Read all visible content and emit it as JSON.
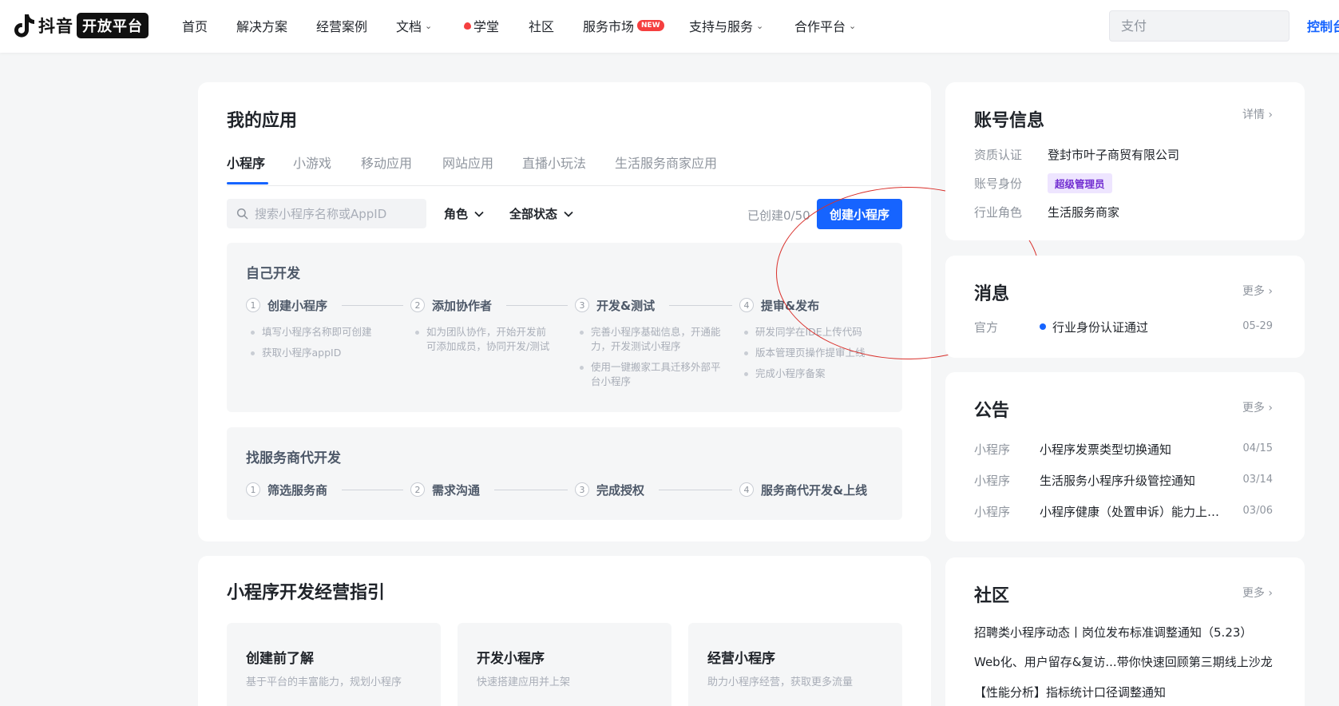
{
  "nav": {
    "logo_text": "抖音",
    "logo_badge": "开放平台",
    "items": [
      {
        "label": "首页"
      },
      {
        "label": "解决方案"
      },
      {
        "label": "经营案例"
      },
      {
        "label": "文档"
      },
      {
        "label": "学堂"
      },
      {
        "label": "社区"
      },
      {
        "label": "服务市场"
      },
      {
        "label": "支持与服务"
      },
      {
        "label": "合作平台"
      }
    ],
    "new_badge": "NEW",
    "search_placeholder": "支付",
    "console_label": "控制台",
    "colors": {
      "accent": "#1664ff",
      "hot": "#f53f3f"
    }
  },
  "my_apps": {
    "title": "我的应用",
    "tabs": [
      "小程序",
      "小游戏",
      "移动应用",
      "网站应用",
      "直播小玩法",
      "生活服务商家应用"
    ],
    "active_tab": "小程序",
    "search_placeholder": "搜索小程序名称或AppID",
    "role_filter": "角色",
    "status_filter": "全部状态",
    "created_count": "已创建0/50",
    "create_button": "创建小程序",
    "self_dev": {
      "title": "自己开发",
      "steps": [
        {
          "num": "1",
          "label": "创建小程序",
          "bullets": [
            "填写小程序名称即可创建",
            "获取小程序appID"
          ]
        },
        {
          "num": "2",
          "label": "添加协作者",
          "bullets": [
            "如为团队协作，开始开发前可添加成员，协同开发/测试"
          ]
        },
        {
          "num": "3",
          "label": "开发&测试",
          "bullets": [
            "完善小程序基础信息，开通能力，开发测试小程序",
            "使用一键搬家工具迁移外部平台小程序"
          ]
        },
        {
          "num": "4",
          "label": "提审&发布",
          "bullets": [
            "研发同学在IDE上传代码",
            "版本管理页操作提审上线",
            "完成小程序备案"
          ]
        }
      ]
    },
    "service_dev": {
      "title": "找服务商代开发",
      "steps": [
        {
          "num": "1",
          "label": "筛选服务商"
        },
        {
          "num": "2",
          "label": "需求沟通"
        },
        {
          "num": "3",
          "label": "完成授权"
        },
        {
          "num": "4",
          "label": "服务商代开发&上线"
        }
      ]
    },
    "annotation_color": "#d9302b"
  },
  "guide": {
    "title": "小程序开发经营指引",
    "cards": [
      {
        "title": "创建前了解",
        "desc": "基于平台的丰富能力，规划小程序"
      },
      {
        "title": "开发小程序",
        "desc": "快速搭建应用并上架"
      },
      {
        "title": "经营小程序",
        "desc": "助力小程序经营，获取更多流量"
      }
    ]
  },
  "account": {
    "title": "账号信息",
    "more": "详情",
    "rows": [
      {
        "label": "资质认证",
        "value": "登封市叶子商贸有限公司"
      },
      {
        "label": "账号身份",
        "value": "超级管理员"
      },
      {
        "label": "行业角色",
        "value": "生活服务商家"
      }
    ]
  },
  "messages": {
    "title": "消息",
    "more": "更多",
    "items": [
      {
        "source": "官方",
        "text": "行业身份认证通过",
        "date": "05-29"
      }
    ]
  },
  "announcements": {
    "title": "公告",
    "more": "更多",
    "items": [
      {
        "tag": "小程序",
        "title": "小程序发票类型切换通知",
        "date": "04/15"
      },
      {
        "tag": "小程序",
        "title": "生活服务小程序升级管控通知",
        "date": "03/14"
      },
      {
        "tag": "小程序",
        "title": "小程序健康（处置申诉）能力上线通知",
        "date": "03/06"
      }
    ]
  },
  "community": {
    "title": "社区",
    "more": "更多",
    "items": [
      "招聘类小程序动态丨岗位发布标准调整通知（5.23）",
      "Web化、用户留存&复访...带你快速回顾第三期线上沙龙",
      "【性能分析】指标统计口径调整通知"
    ]
  }
}
